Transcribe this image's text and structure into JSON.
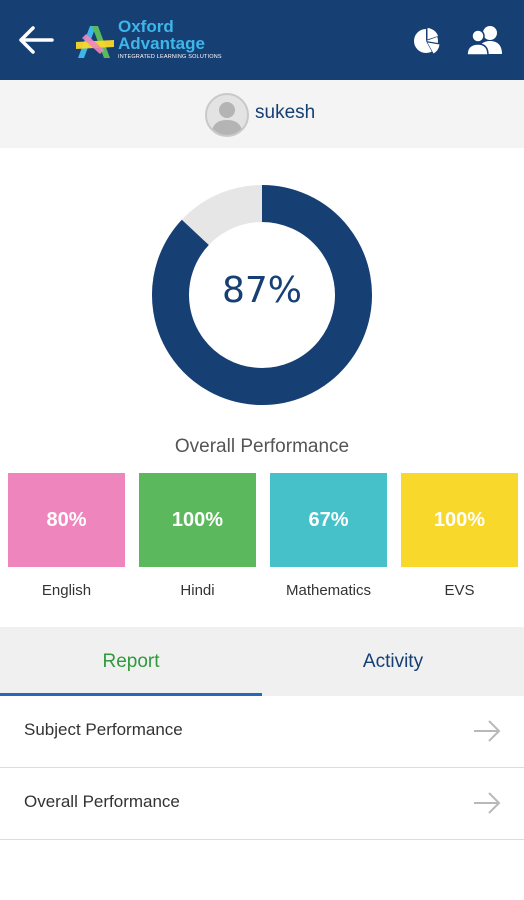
{
  "header": {
    "logo_line1": "Oxford",
    "logo_line2": "Advantage",
    "logo_tagline": "INTEGRATED LEARNING SOLUTIONS"
  },
  "user": {
    "name": "sukesh"
  },
  "overall": {
    "percent_label": "87%",
    "fraction": 0.87,
    "title": "Overall Performance"
  },
  "subjects": [
    {
      "name": "English",
      "score": "80%",
      "color": "#ee86bd"
    },
    {
      "name": "Hindi",
      "score": "100%",
      "color": "#5bb85c"
    },
    {
      "name": "Mathematics",
      "score": "67%",
      "color": "#47c1c9"
    },
    {
      "name": "EVS",
      "score": "100%",
      "color": "#f9d82c"
    }
  ],
  "tabs": [
    {
      "label": "Report",
      "active": true,
      "color": "#2e9a3c"
    },
    {
      "label": "Activity",
      "active": false,
      "color": "#163f74"
    }
  ],
  "rows": [
    {
      "label": "Subject Performance"
    },
    {
      "label": "Overall Performance"
    }
  ],
  "colors": {
    "primary": "#163f74",
    "donut_rest": "#e6e6e6"
  }
}
